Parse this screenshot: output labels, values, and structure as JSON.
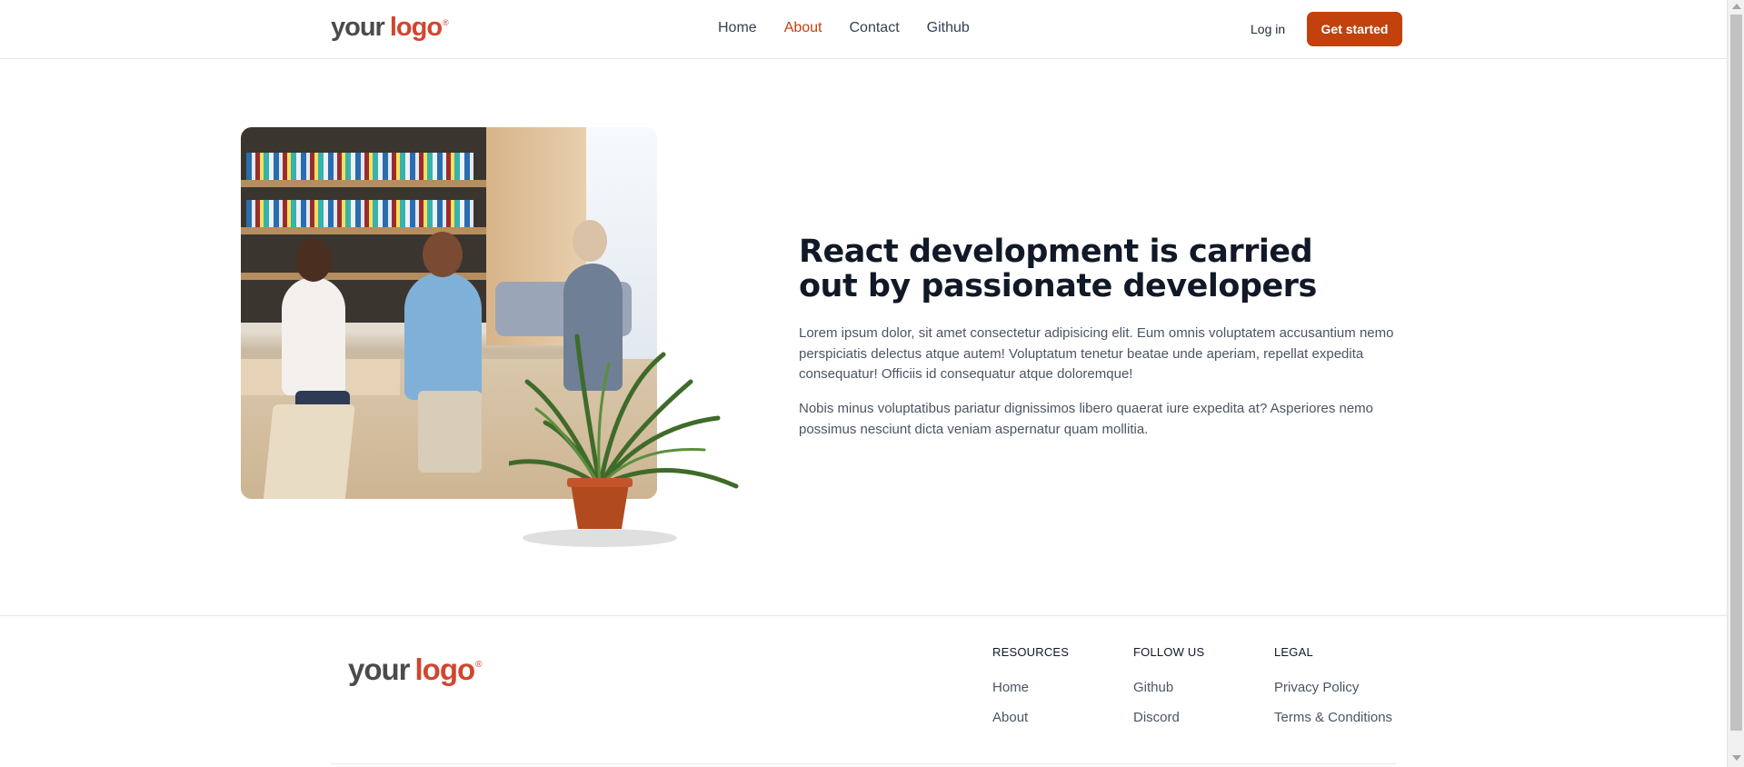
{
  "header": {
    "logo": {
      "word1": "your",
      "word2": "logo",
      "mark": "®"
    },
    "nav": [
      {
        "label": "Home"
      },
      {
        "label": "About"
      },
      {
        "label": "Contact"
      },
      {
        "label": "Github"
      }
    ],
    "login_label": "Log in",
    "cta_label": "Get started"
  },
  "hero": {
    "image": "office-team-meeting-photo",
    "heading": "React development is carried out by passionate developers",
    "paragraphs": [
      "Lorem ipsum dolor, sit amet consectetur adipisicing elit. Eum omnis voluptatem accusantium nemo perspiciatis delectus atque autem! Voluptatum tenetur beatae unde aperiam, repellat expedita consequatur! Officiis id consequatur atque doloremque!",
      "Nobis minus voluptatibus pariatur dignissimos libero quaerat iure expedita at? Asperiores nemo possimus nesciunt dicta veniam aspernatur quam mollitia."
    ]
  },
  "footer": {
    "logo": {
      "word1": "your",
      "word2": "logo",
      "mark": "®"
    },
    "columns": [
      {
        "title": "RESOURCES",
        "links": [
          "Home",
          "About"
        ]
      },
      {
        "title": "FOLLOW US",
        "links": [
          "Github",
          "Discord"
        ]
      },
      {
        "title": "LEGAL",
        "links": [
          "Privacy Policy",
          "Terms & Conditions"
        ]
      }
    ]
  },
  "colors": {
    "accent": "#c2410c",
    "logo_red": "#d2452f",
    "heading": "#111827",
    "body_text": "#4b5563"
  }
}
